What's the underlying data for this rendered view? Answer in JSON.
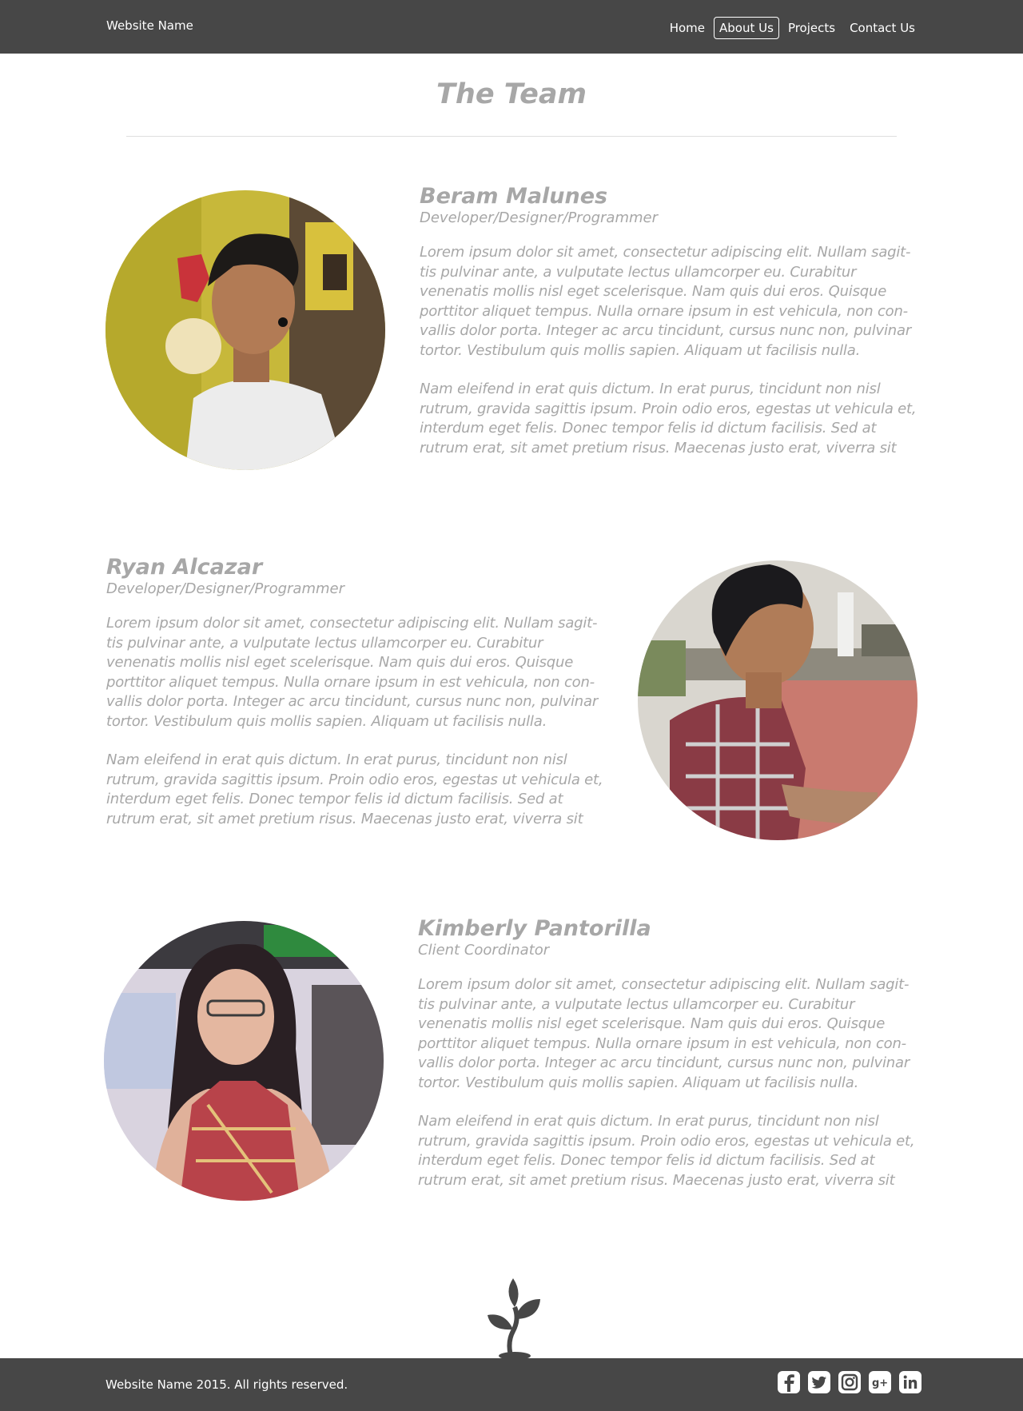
{
  "header": {
    "brand": "Website Name",
    "nav": [
      {
        "label": "Home",
        "active": false
      },
      {
        "label": "About Us",
        "active": true
      },
      {
        "label": "Projects",
        "active": false
      },
      {
        "label": "Contact Us",
        "active": false
      }
    ]
  },
  "page": {
    "title": "The Team"
  },
  "members": [
    {
      "name": "Beram Malunes",
      "role": "Developer/Designer/Programmer",
      "bio1": "Lorem ipsum dolor sit amet, consectetur adipiscing elit. Nullam sagit-tis pulvinar ante, a vulputate lectus ullamcorper eu. Curabitur venenatis mollis nisl eget scelerisque. Nam quis dui eros. Quisque porttitor aliquet tempus. Nulla ornare ipsum in est vehicula, non con-vallis dolor porta. Integer ac arcu tincidunt, cursus nunc non, pulvinar tortor. Vestibulum quis mollis sapien. Aliquam ut facilisis nulla.",
      "bio2": "Nam eleifend in erat quis dictum. In erat purus, tincidunt non nisl rutrum, gravida sagittis ipsum. Proin odio eros, egestas ut vehicula et, interdum eget felis. Donec tempor felis id dictum facilisis. Sed at rutrum erat, sit amet pretium risus. Maecenas justo erat, viverra sit"
    },
    {
      "name": "Ryan Alcazar",
      "role": "Developer/Designer/Programmer",
      "bio1": "Lorem ipsum dolor sit amet, consectetur adipiscing elit. Nullam sagit-tis pulvinar ante, a vulputate lectus ullamcorper eu. Curabitur venenatis mollis nisl eget scelerisque. Nam quis dui eros. Quisque porttitor aliquet tempus. Nulla ornare ipsum in est vehicula, non con-vallis dolor porta. Integer ac arcu tincidunt, cursus nunc non, pulvinar tortor. Vestibulum quis mollis sapien. Aliquam ut facilisis nulla.",
      "bio2": "Nam eleifend in erat quis dictum. In erat purus, tincidunt non nisl rutrum, gravida sagittis ipsum. Proin odio eros, egestas ut vehicula et, interdum eget felis. Donec tempor felis id dictum facilisis. Sed at rutrum erat, sit amet pretium risus. Maecenas justo erat, viverra sit"
    },
    {
      "name": "Kimberly Pantorilla",
      "role": "Client Coordinator",
      "bio1": "Lorem ipsum dolor sit amet, consectetur adipiscing elit. Nullam sagit-tis pulvinar ante, a vulputate lectus ullamcorper eu. Curabitur venenatis mollis nisl eget scelerisque. Nam quis dui eros. Quisque porttitor aliquet tempus. Nulla ornare ipsum in est vehicula, non con-vallis dolor porta. Integer ac arcu tincidunt, cursus nunc non, pulvinar tortor. Vestibulum quis mollis sapien. Aliquam ut facilisis nulla.",
      "bio2": "Nam eleifend in erat quis dictum. In erat purus, tincidunt non nisl rutrum, gravida sagittis ipsum. Proin odio eros, egestas ut vehicula et, interdum eget felis. Donec tempor felis id dictum facilisis. Sed at rutrum erat, sit amet pretium risus. Maecenas justo erat, viverra sit"
    }
  ],
  "footer": {
    "copyright": "Website Name 2015. All rights reserved.",
    "social": [
      {
        "icon": "facebook-icon"
      },
      {
        "icon": "twitter-icon"
      },
      {
        "icon": "instagram-icon"
      },
      {
        "icon": "google-plus-icon"
      },
      {
        "icon": "linkedin-icon"
      }
    ],
    "logo": "plant-sprout-icon"
  },
  "colors": {
    "bar": "#474747",
    "text_muted": "#a7a7a7",
    "white": "#ffffff"
  }
}
